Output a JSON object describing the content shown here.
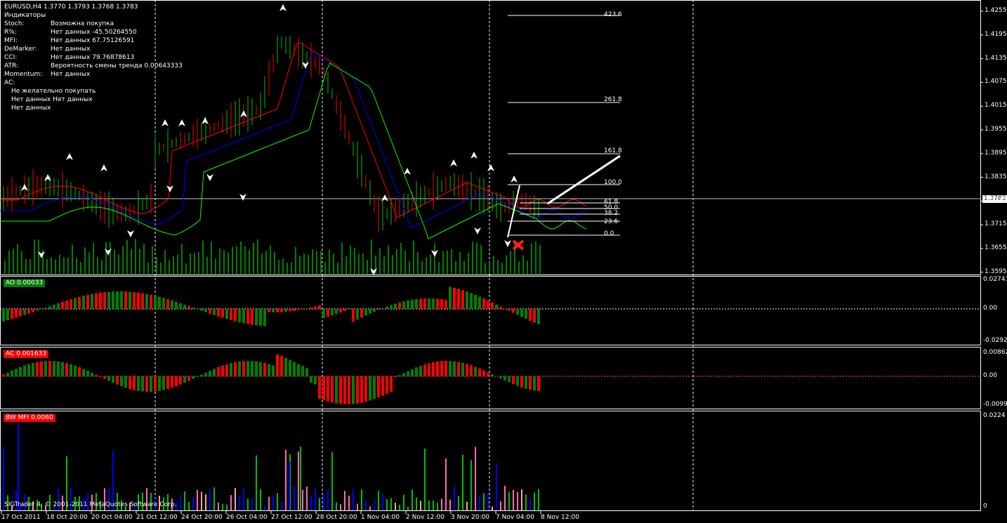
{
  "header": {
    "symbol_line": "EURUSD,H4  1.3770 1.3793 1.3768 1.3783",
    "title": "Индикаторы",
    "rows": [
      {
        "k": "Stoch:",
        "v": "Возможна покупка"
      },
      {
        "k": "R%:",
        "v": "  Нет данных -45.50264550"
      },
      {
        "k": "MFI:",
        "v": "  Нет данных 67.75126591"
      },
      {
        "k": "DeMarker:",
        "v": "Нет данных"
      },
      {
        "k": "CCI:",
        "v": "  Нет данных 79.76878613"
      },
      {
        "k": "ATR:",
        "v": "  Вероятность смены тренда 0.00643333"
      },
      {
        "k": "Momentum:",
        "v": "Нет данных"
      },
      {
        "k": "AC:",
        "v": ""
      }
    ],
    "ac_notes": [
      "Не желательно покупать",
      "Нет данных Нет данных",
      "Нет данных"
    ]
  },
  "price_axis": [
    "1.4255",
    "1.4195",
    "1.4135",
    "1.4075",
    "1.4015",
    "1.3955",
    "1.3895",
    "1.3835",
    "1.3775",
    "1.3715",
    "1.3655",
    "1.3595"
  ],
  "current_price": "1.3783",
  "fib_levels": [
    "423.6",
    "261.8",
    "161.8",
    "100.0",
    "61.8",
    "50.0",
    "38.2",
    "23.6",
    "0.0"
  ],
  "panels": {
    "ao": {
      "label": "AO 0.00033",
      "color": "#008000",
      "axis": [
        "0.02741",
        "0.00",
        "-0.02929"
      ]
    },
    "ac": {
      "label": "AC 0.001633",
      "color": "#ff0000",
      "axis": [
        "0.00862",
        "0.00",
        "-0.00996"
      ]
    },
    "mfi": {
      "label": "BW MFI 0.0060",
      "color": "#ff0000",
      "axis": [
        "0.0224",
        "0"
      ]
    }
  },
  "time_axis": [
    "17 Oct 2011",
    "18 Oct 20:00",
    "20 Oct 04:00",
    "21 Oct 12:00",
    "24 Oct 20:00",
    "26 Oct 04:00",
    "27 Oct 12:00",
    "28 Oct 20:00",
    "1 Nov 04:00",
    "2 Nov 12:00",
    "3 Nov 20:00",
    "7 Nov 04:00",
    "8 Nov 12:00"
  ],
  "copyright": "SIGTrader 4, © 2001-2011 MetaQuotes Software Corp.",
  "colors": {
    "bull": "#00c000",
    "bear": "#ff0000",
    "ma_red": "#ff0000",
    "ma_blue": "#0000ff",
    "ma_green": "#00ff00",
    "volume": "#00ff00",
    "grid": "#ffffff"
  }
}
